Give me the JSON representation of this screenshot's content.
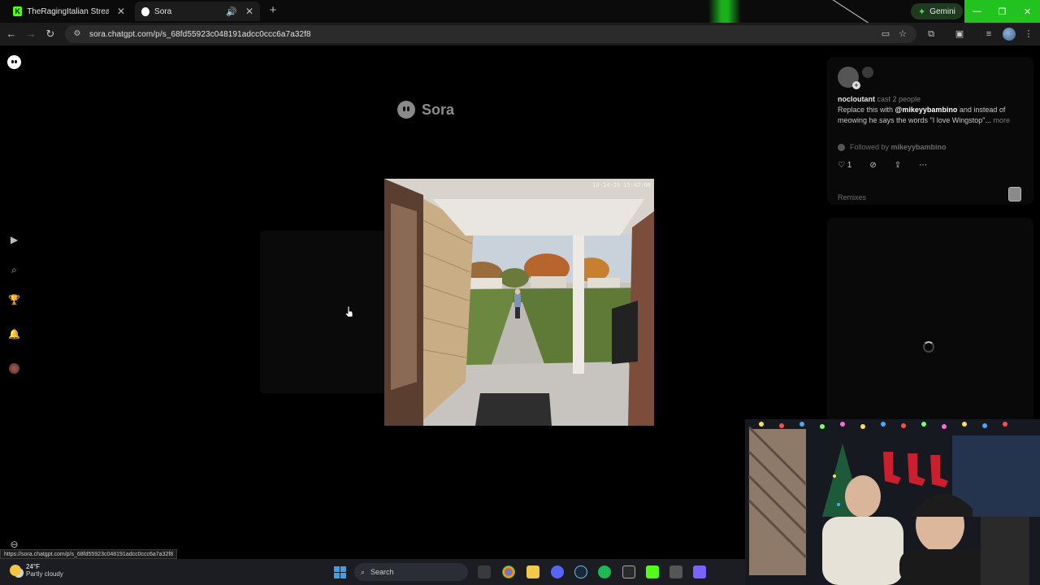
{
  "browser": {
    "tabs": [
      {
        "title": "TheRagingItalian Stream - Wat",
        "favicon": "kick-icon"
      },
      {
        "title": "Sora",
        "favicon": "sora-icon",
        "audio": true
      }
    ],
    "new_tab": "+",
    "gemini_label": "Gemini",
    "url": "sora.chatgpt.com/p/s_68fd55923c048191adcc0ccc6a7a32f8",
    "accent_color": "#22c21f"
  },
  "page": {
    "brand": "Sora",
    "video": {
      "timestamp": "10-14-25 15:42:06"
    },
    "post": {
      "author": "nocloutant",
      "cast_note": "cast 2 people",
      "caption_prefix": "Replace this with ",
      "mention": "@mikeyybambino",
      "caption_rest": " and instead of meowing he says the words \"I love Wingstop\"...",
      "more_label": "more",
      "followed_prefix": "Followed by ",
      "followed_by": "mikeyybambino",
      "likes": "1",
      "remixes_label": "Remixes"
    }
  },
  "status_url": "https://sora.chatgpt.com/p/s_68fd55923c048191adcc0ccc6a7a32f8",
  "taskbar": {
    "temperature": "24°F",
    "weather": "Partly cloudy",
    "search_placeholder": "Search"
  }
}
